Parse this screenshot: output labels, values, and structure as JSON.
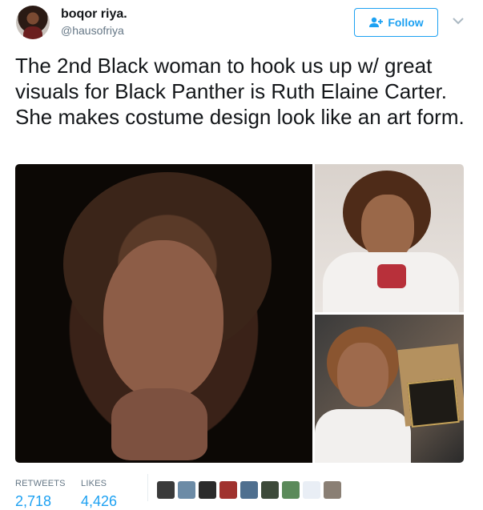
{
  "author": {
    "name": "boqor riya.",
    "handle": "@hausofriya",
    "avatar_icon": "profile-photo"
  },
  "follow_button": {
    "label": "Follow",
    "icon": "add-user-icon",
    "color": "#1da1f2"
  },
  "menu": {
    "icon": "chevron-down-icon"
  },
  "tweet": {
    "text": "The 2nd Black woman to hook us up w/ great visuals for Black Panther is Ruth Elaine Carter. She makes costume design look like an art form."
  },
  "media": {
    "photos": [
      "portrait-photo",
      "smiling-photo",
      "award-photo"
    ]
  },
  "stats": {
    "retweets_label": "RETWEETS",
    "retweets_value": "2,718",
    "likes_label": "LIKES",
    "likes_value": "4,426"
  },
  "likers": {
    "colors": [
      "#3a3a3a",
      "#6c8ba6",
      "#2b2b2b",
      "#a0322e",
      "#4f6f8f",
      "#3d4a3a",
      "#5b8a5a",
      "#e9eef5",
      "#8a7f74"
    ]
  },
  "colors": {
    "accent": "#1da1f2",
    "muted": "#657786",
    "text": "#14171a"
  }
}
